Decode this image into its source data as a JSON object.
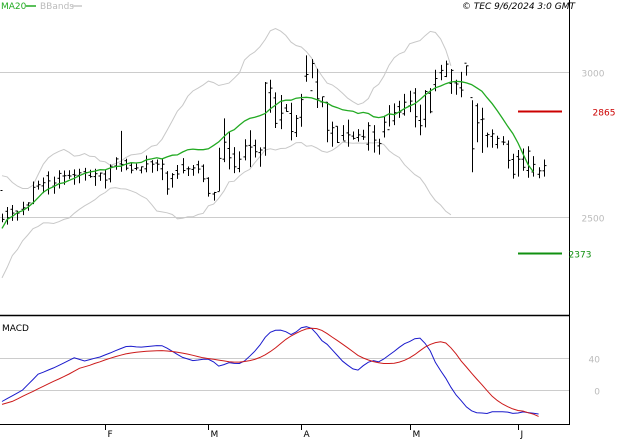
{
  "header": {
    "ma_label": "MA20",
    "bb_label": "BBands",
    "copyright": "© TEC 9/6/2024 3:0 GMT"
  },
  "macd_panel": {
    "title": "MACD"
  },
  "colors": {
    "ma": "#22aa22",
    "bbands": "#c8c8c8",
    "bars": "#000000",
    "resistance": "#cc0000",
    "support": "#109010",
    "macd": "#1a1acc",
    "signal": "#cc1a1a",
    "grid": "#cccccc",
    "frame": "#000000"
  },
  "chart_data": [
    {
      "type": "ohlc",
      "name": "price",
      "ylim": [
        2170,
        3200
      ],
      "y_ticks": [
        {
          "value": 2500,
          "label": "2500"
        },
        {
          "value": 3000,
          "label": "3000"
        }
      ],
      "levels": [
        {
          "value": 2865,
          "label": "2865",
          "kind": "resistance"
        },
        {
          "value": 2373,
          "label": "2373",
          "kind": "support"
        }
      ],
      "x_ticks": [
        {
          "index": 20,
          "label": "F"
        },
        {
          "index": 40,
          "label": "M"
        },
        {
          "index": 58,
          "label": "A"
        },
        {
          "index": 79,
          "label": "M"
        },
        {
          "index": 100,
          "label": "J"
        }
      ],
      "ohlc": [
        [
          2590,
          2510,
          2480,
          2490
        ],
        [
          2518,
          2533,
          2472,
          2496
        ],
        [
          2525,
          2540,
          2485,
          2512
        ],
        [
          2519,
          2520,
          2486,
          2512
        ],
        [
          2525,
          2551,
          2505,
          2530
        ],
        [
          2540,
          2549,
          2520,
          2547
        ],
        [
          2546,
          2621,
          2543,
          2601
        ],
        [
          2605,
          2624,
          2593,
          2610
        ],
        [
          2606,
          2635,
          2581,
          2617
        ],
        [
          2641,
          2656,
          2576,
          2623
        ],
        [
          2605,
          2638,
          2579,
          2616
        ],
        [
          2632,
          2660,
          2597,
          2649
        ],
        [
          2640,
          2659,
          2610,
          2641
        ],
        [
          2642,
          2660,
          2630,
          2640
        ],
        [
          2645,
          2663,
          2610,
          2643
        ],
        [
          2642,
          2665,
          2615,
          2651
        ],
        [
          2655,
          2668,
          2624,
          2652
        ],
        [
          2642,
          2662,
          2634,
          2638
        ],
        [
          2638,
          2665,
          2606,
          2648
        ],
        [
          2640,
          2652,
          2623,
          2650
        ],
        [
          2647,
          2661,
          2597,
          2626
        ],
        [
          2630,
          2680,
          2618,
          2674
        ],
        [
          2675,
          2705,
          2662,
          2699
        ],
        [
          2682,
          2796,
          2655,
          2680
        ],
        [
          2693,
          2700,
          2660,
          2667
        ],
        [
          2677,
          2685,
          2649,
          2660
        ],
        [
          2666,
          2683,
          2660,
          2668
        ],
        [
          2660,
          2673,
          2649,
          2672
        ],
        [
          2665,
          2711,
          2653,
          2682
        ],
        [
          2689,
          2695,
          2651,
          2681
        ],
        [
          2685,
          2697,
          2657,
          2681
        ],
        [
          2665,
          2698,
          2626,
          2681
        ],
        [
          2650,
          2657,
          2575,
          2595
        ],
        [
          2631,
          2650,
          2600,
          2645
        ],
        [
          2659,
          2678,
          2630,
          2647
        ],
        [
          2679,
          2702,
          2649,
          2659
        ],
        [
          2665,
          2673,
          2640,
          2665
        ],
        [
          2663,
          2678,
          2641,
          2668
        ],
        [
          2679,
          2693,
          2649,
          2664
        ],
        [
          2674,
          2680,
          2619,
          2630
        ],
        [
          2632,
          2636,
          2569,
          2580
        ],
        [
          2578,
          2585,
          2555,
          2583
        ],
        [
          2586,
          2738,
          2588,
          2701
        ],
        [
          2698,
          2839,
          2688,
          2757
        ],
        [
          2735,
          2793,
          2663,
          2703
        ],
        [
          2716,
          2740,
          2650,
          2672
        ],
        [
          2666,
          2725,
          2653,
          2698
        ],
        [
          2706,
          2767,
          2694,
          2744
        ],
        [
          2746,
          2798,
          2671,
          2740
        ],
        [
          2745,
          2766,
          2704,
          2724
        ],
        [
          2721,
          2739,
          2672,
          2730
        ],
        [
          2737,
          2965,
          2710,
          2961
        ],
        [
          2928,
          2973,
          2859,
          2944
        ],
        [
          2910,
          2929,
          2806,
          2822
        ],
        [
          2834,
          2920,
          2802,
          2857
        ],
        [
          2875,
          2889,
          2862,
          2863
        ],
        [
          2856,
          2893,
          2763,
          2794
        ],
        [
          2790,
          2851,
          2775,
          2839
        ],
        [
          2843,
          2924,
          2810,
          2904
        ],
        [
          2985,
          3057,
          2966,
          2991
        ],
        [
          2935,
          3044,
          2978,
          3029
        ],
        [
          2965,
          3011,
          2875,
          2907
        ],
        [
          2896,
          2914,
          2878,
          2914
        ],
        [
          2895,
          2896,
          2757,
          2798
        ],
        [
          2788,
          2828,
          2741,
          2807
        ],
        [
          2812,
          2812,
          2754,
          2756
        ],
        [
          2780,
          2816,
          2763,
          2761
        ],
        [
          2789,
          2835,
          2741,
          2782
        ],
        [
          2778,
          2794,
          2766,
          2770
        ],
        [
          2773,
          2802,
          2759,
          2782
        ],
        [
          2777,
          2800,
          2765,
          2775
        ],
        [
          2750,
          2826,
          2728,
          2814
        ],
        [
          2792,
          2816,
          2721,
          2764
        ],
        [
          2744,
          2769,
          2714,
          2752
        ],
        [
          2793,
          2848,
          2773,
          2826
        ],
        [
          2800,
          2885,
          2811,
          2854
        ],
        [
          2831,
          2891,
          2816,
          2859
        ],
        [
          2880,
          2900,
          2841,
          2861
        ],
        [
          2855,
          2924,
          2849,
          2895
        ],
        [
          2883,
          2935,
          2861,
          2899
        ],
        [
          2927,
          2944,
          2808,
          2845
        ],
        [
          2832,
          2887,
          2781,
          2814
        ],
        [
          2836,
          2937,
          2808,
          2932
        ],
        [
          2926,
          2944,
          2857,
          2862
        ],
        [
          2956,
          3007,
          2933,
          2977
        ],
        [
          2997,
          3024,
          2971,
          3005
        ],
        [
          2984,
          3039,
          2982,
          3027
        ],
        [
          2960,
          3010,
          2924,
          3005
        ],
        [
          2962,
          2973,
          2921,
          2958
        ],
        [
          2945,
          3000,
          2912,
          2937
        ],
        [
          3030,
          3022,
          2987,
          3021
        ],
        [
          2911,
          2902,
          2653,
          2734
        ],
        [
          2883,
          2891,
          2757,
          2824
        ],
        [
          2835,
          2876,
          2720,
          2837
        ],
        [
          2780,
          2790,
          2739,
          2783
        ],
        [
          2777,
          2801,
          2738,
          2786
        ],
        [
          2749,
          2779,
          2735,
          2770
        ],
        [
          2758,
          2778,
          2747,
          2757
        ],
        [
          2750,
          2763,
          2666,
          2694
        ],
        [
          2697,
          2717,
          2631,
          2646
        ],
        [
          2707,
          2730,
          2638,
          2698
        ],
        [
          2698,
          2735,
          2658,
          2670
        ],
        [
          2659,
          2743,
          2634,
          2726
        ],
        [
          2654,
          2709,
          2638,
          2680
        ],
        [
          2646,
          2670,
          2632,
          2658
        ],
        [
          2658,
          2697,
          2638,
          2676
        ]
      ],
      "ma20": [
        2459,
        2490,
        2500,
        2514,
        2520,
        2532,
        2547,
        2565,
        2584,
        2595,
        2603,
        2613,
        2617,
        2625,
        2632,
        2641,
        2649,
        2654,
        2657,
        2662,
        2661,
        2668,
        2673,
        2674,
        2681,
        2686,
        2685,
        2687,
        2696,
        2699,
        2703,
        2699,
        2706,
        2712,
        2713,
        2723,
        2731,
        2733,
        2731,
        2731,
        2734,
        2746,
        2758,
        2776,
        2792,
        2800,
        2816,
        2830,
        2839,
        2843,
        2849,
        2856,
        2872,
        2885,
        2898,
        2902,
        2902,
        2909,
        2911,
        2912,
        2910,
        2904,
        2897,
        2892,
        2882,
        2876,
        2869,
        2866,
        2864,
        2856,
        2860,
        2856,
        2845,
        2842,
        2845,
        2855,
        2852,
        2862,
        2873,
        2882,
        2890,
        2904,
        2920,
        2934,
        2945,
        2951,
        2959,
        2965,
        2967,
        2966,
        2962,
        2956,
        2945,
        2933,
        2911,
        2890,
        2865,
        2839,
        2812,
        2787,
        2754,
        2715,
        2678,
        2654
      ],
      "bb_upper": [
        2641,
        2637,
        2618,
        2605,
        2597,
        2597,
        2608,
        2645,
        2681,
        2703,
        2716,
        2725,
        2732,
        2722,
        2709,
        2711,
        2718,
        2708,
        2707,
        2692,
        2689,
        2677,
        2683,
        2691,
        2704,
        2713,
        2715,
        2718,
        2730,
        2743,
        2747,
        2767,
        2798,
        2831,
        2864,
        2884,
        2916,
        2934,
        2944,
        2955,
        2968,
        2963,
        2953,
        2957,
        2961,
        2978,
        2996,
        3041,
        3058,
        3069,
        3087,
        3112,
        3142,
        3150,
        3141,
        3126,
        3103,
        3091,
        3086,
        3070,
        3048,
        3012,
        2986,
        2961,
        2955,
        2942,
        2926,
        2909,
        2897,
        2887,
        2893,
        2908,
        2944,
        2957,
        2985,
        3023,
        3049,
        3062,
        3069,
        3097,
        3103,
        3108,
        3125,
        3140,
        3136,
        3114,
        3076,
        3021
      ],
      "bb_lower": [
        2288,
        2324,
        2365,
        2386,
        2416,
        2436,
        2458,
        2466,
        2478,
        2478,
        2476,
        2482,
        2490,
        2495,
        2511,
        2525,
        2537,
        2547,
        2558,
        2573,
        2583,
        2598,
        2600,
        2596,
        2595,
        2589,
        2582,
        2571,
        2562,
        2542,
        2519,
        2516,
        2513,
        2507,
        2492,
        2494,
        2499,
        2499,
        2507,
        2511,
        2537,
        2543,
        2563,
        2588,
        2620,
        2622,
        2640,
        2654,
        2663,
        2686,
        2707,
        2730,
        2734,
        2730,
        2735,
        2736,
        2744,
        2755,
        2756,
        2743,
        2745,
        2737,
        2726,
        2722,
        2729,
        2741,
        2757,
        2755,
        2753,
        2754,
        2753,
        2755,
        2754,
        2756,
        2749,
        2728,
        2714,
        2704,
        2679,
        2662,
        2645,
        2634,
        2610,
        2579,
        2555,
        2540,
        2518,
        2506
      ]
    },
    {
      "type": "line",
      "name": "MACD",
      "ylim": [
        -40,
        90
      ],
      "y_ticks": [
        {
          "value": 40,
          "label": "40"
        },
        {
          "value": 0,
          "label": "0"
        }
      ],
      "series": [
        {
          "key": "macd",
          "values": [
            -14.4,
            -10.8,
            -7.2,
            -3.6,
            0.0,
            6.6,
            13.1,
            19.7,
            22.3,
            25.0,
            27.6,
            30.8,
            33.9,
            37.1,
            40.2,
            38.2,
            36.3,
            38.0,
            39.7,
            41.3,
            43.9,
            46.4,
            49.1,
            51.8,
            54.3,
            54.7,
            53.9,
            53.6,
            54.2,
            54.9,
            55.5,
            55.4,
            52.3,
            48.4,
            44.5,
            40.7,
            38.7,
            36.7,
            37.5,
            38.5,
            38.4,
            35.1,
            29.9,
            31.7,
            34.3,
            33.2,
            33.1,
            36.2,
            42.2,
            48.5,
            56.2,
            65.9,
            72.1,
            74.6,
            74.9,
            72.9,
            69.3,
            72.5,
            77.9,
            79.1,
            77.0,
            70.1,
            61.7,
            57.1,
            50.3,
            43.1,
            36.0,
            31.0,
            26.4,
            24.9,
            30.4,
            34.8,
            36.8,
            35.2,
            38.7,
            43.6,
            48.3,
            53.4,
            57.9,
            60.5,
            64.1,
            64.9,
            58.3,
            48.7,
            34.5,
            24.2,
            14.6,
            3.5,
            -6.2,
            -13.4,
            -21.1,
            -26.0,
            -28.4,
            -28.7,
            -29.4,
            -27.3,
            -27.2,
            -27.2,
            -27.6,
            -29.3,
            -28.8,
            -27.4,
            -28.3,
            -29.1,
            -30.0
          ]
        },
        {
          "key": "signal",
          "values": [
            -18.0,
            -16.1,
            -14.2,
            -11.1,
            -7.9,
            -4.8,
            -1.7,
            1.5,
            4.6,
            7.8,
            10.9,
            13.8,
            16.8,
            20.0,
            23.5,
            27.1,
            29.0,
            30.9,
            33.2,
            35.3,
            37.6,
            39.8,
            41.7,
            43.5,
            45.1,
            46.3,
            47.2,
            47.8,
            48.4,
            48.7,
            49.1,
            49.2,
            48.8,
            48.1,
            47.2,
            46.1,
            44.9,
            43.4,
            41.8,
            40.3,
            39.2,
            38.4,
            37.4,
            36.4,
            35.4,
            34.9,
            34.9,
            35.6,
            36.7,
            38.3,
            40.7,
            44.0,
            48.0,
            52.6,
            58.0,
            63.3,
            67.5,
            70.9,
            74.0,
            76.4,
            77.3,
            76.8,
            74.5,
            70.5,
            66.1,
            61.8,
            57.3,
            52.8,
            48.0,
            43.3,
            40.0,
            37.5,
            35.5,
            34.0,
            33.1,
            33.1,
            33.5,
            34.9,
            37.1,
            40.3,
            44.3,
            49.1,
            53.6,
            57.0,
            59.3,
            60.2,
            58.8,
            52.8,
            45.1,
            36.1,
            28.7,
            21.0,
            13.7,
            6.6,
            -0.7,
            -7.9,
            -13.2,
            -17.5,
            -20.9,
            -23.6,
            -25.6,
            -26.4,
            -28.5,
            -30.3,
            -33.0
          ]
        }
      ]
    }
  ]
}
